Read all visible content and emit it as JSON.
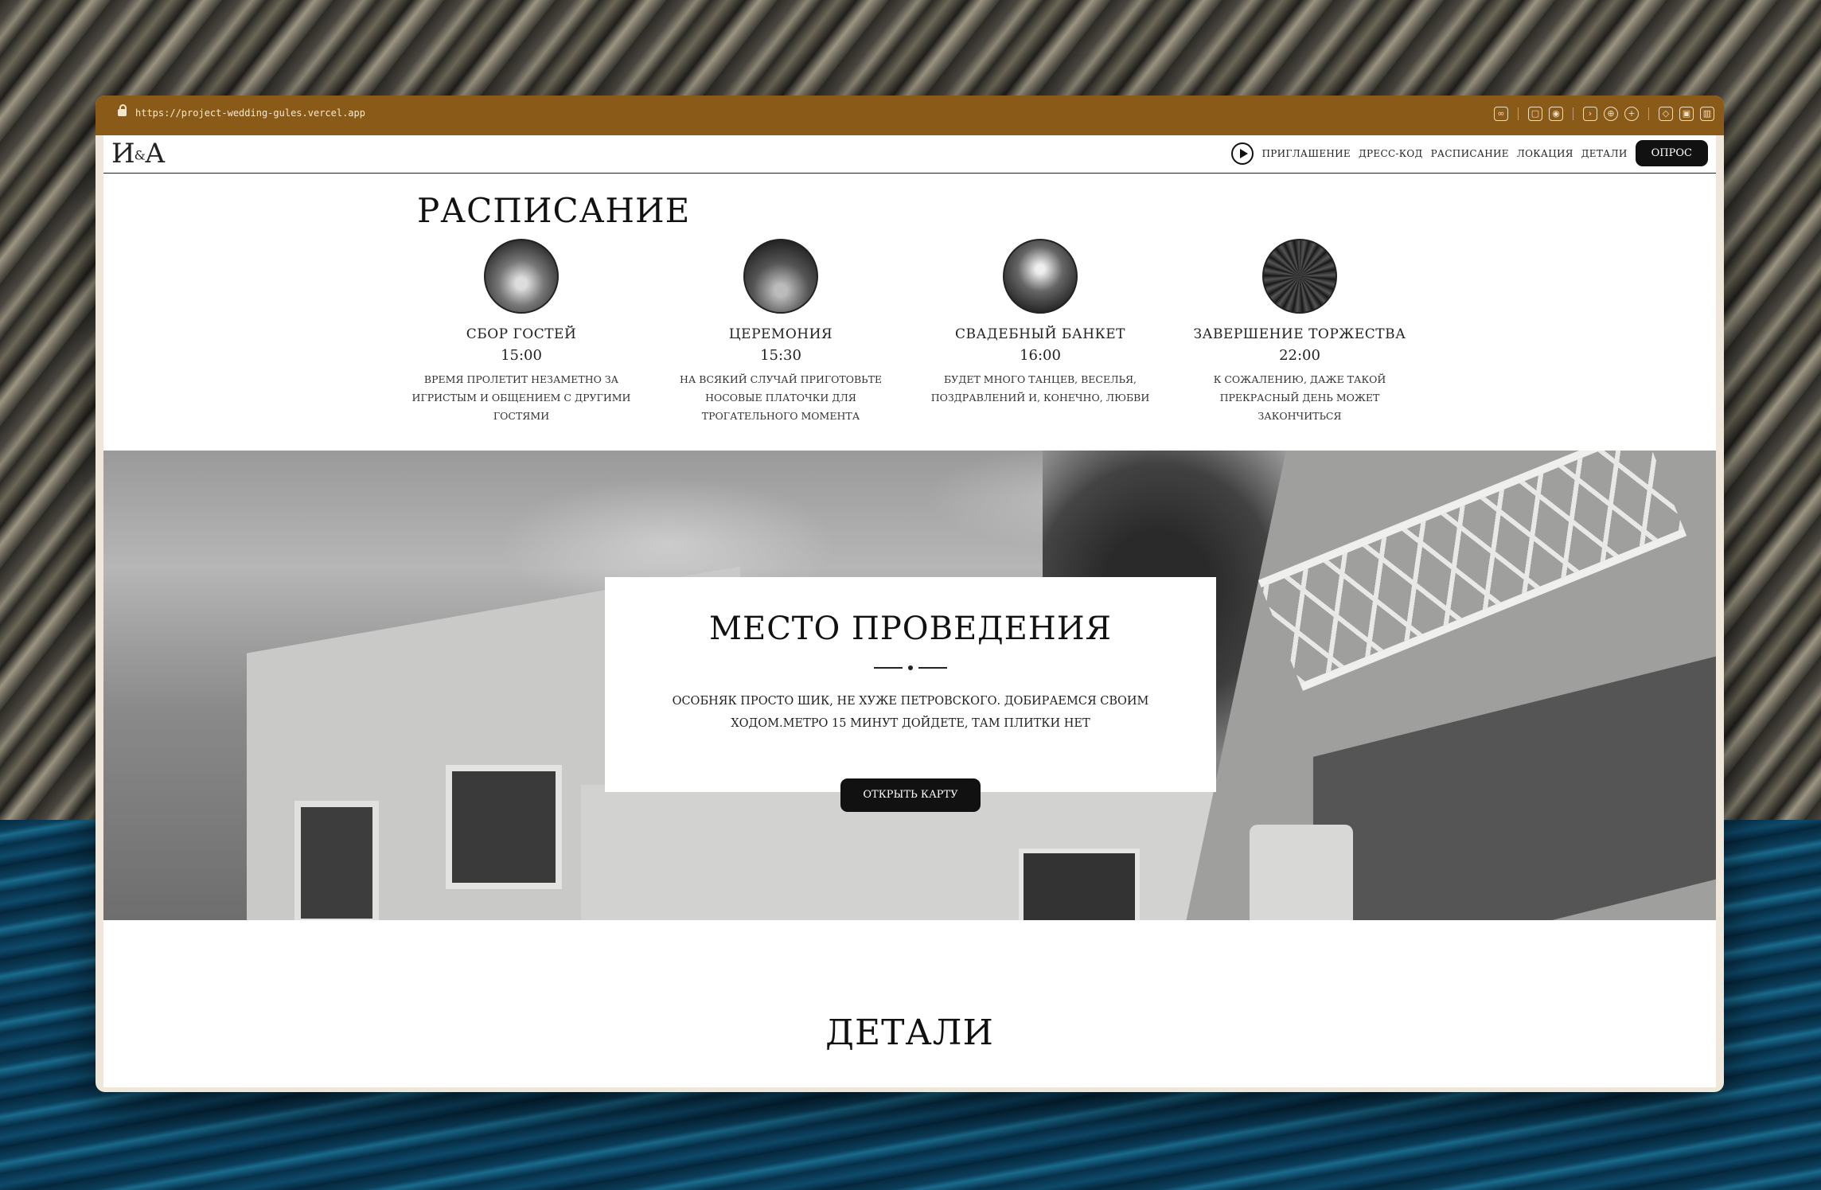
{
  "browser": {
    "url": "https://project-wedding-gules.vercel.app"
  },
  "nav": {
    "logo": "И&А",
    "logo_left": "И",
    "logo_amp": "&",
    "logo_right": "А",
    "links": [
      "Приглашение",
      "Дресс-код",
      "Расписание",
      "Локация",
      "Детали"
    ],
    "cta": "Опрос"
  },
  "schedule": {
    "title": "Расписание",
    "events": [
      {
        "name": "Сбор гостей",
        "time": "15:00",
        "description": "Время пролетит незаметно за игристым и общением с другими гостями"
      },
      {
        "name": "Церемония",
        "time": "15:30",
        "description": "На всякий случай приготовьте носовые платочки для трогательного момента"
      },
      {
        "name": "Свадебный банкет",
        "time": "16:00",
        "description": "Будет много танцев, веселья, поздравлений и, конечно, любви"
      },
      {
        "name": "Завершение торжества",
        "time": "22:00",
        "description": "К сожалению, даже такой прекрасный день может закончиться"
      }
    ]
  },
  "venue": {
    "title": "Место проведения",
    "description": "Особняк просто шик, не хуже Петровского. Добираемся своим ходом.Метро 15 минут дойдете, там плитки нет",
    "button": "Открыть карту"
  },
  "details": {
    "title": "Детали"
  }
}
